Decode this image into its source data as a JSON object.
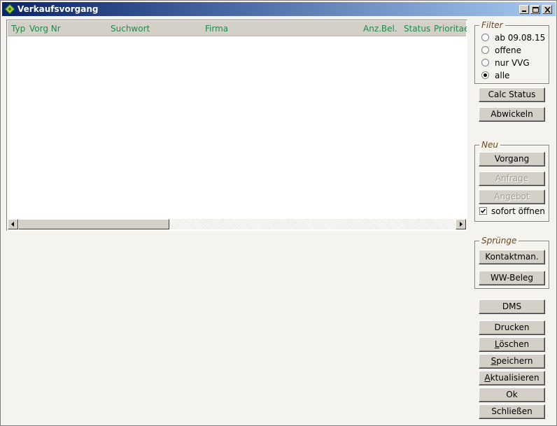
{
  "window": {
    "title": "Verkaufsvorgang",
    "icons": {
      "app": "green-diamond-arrows-icon",
      "minimize": "minimize-icon",
      "maximize": "maximize-icon",
      "close": "close-icon"
    }
  },
  "list": {
    "columns": [
      "Typ",
      "Vorg Nr",
      "Suchwort",
      "Firma",
      "Anz.Bel.",
      "Status",
      "Prioritae"
    ],
    "rows": [],
    "header_text_color": "#1e8a4a"
  },
  "filter": {
    "title": "Filter",
    "options": [
      {
        "label": "ab 09.08.15",
        "checked": false
      },
      {
        "label": "offene",
        "checked": false
      },
      {
        "label": "nur VVG",
        "checked": false
      },
      {
        "label": "alle",
        "checked": true
      }
    ]
  },
  "buttons": {
    "calc_status": "Calc Status",
    "abwickeln": "Abwickeln",
    "dms": "DMS",
    "drucken": "Drucken",
    "loeschen_rest": "öschen",
    "loeschen_accel": "L",
    "speichern_rest": "peichern",
    "speichern_accel": "S",
    "aktualisieren_rest": "ktualisieren",
    "aktualisieren_accel": "A",
    "ok": "Ok",
    "schliessen": "Schließen"
  },
  "neu": {
    "title": "Neu",
    "vorgang": "Vorgang",
    "anfrage": "Anfrage",
    "angebot": "Angebot",
    "sofort_oeffnen": "sofort öffnen",
    "sofort_oeffnen_checked": true
  },
  "spruenge": {
    "title": "Sprünge",
    "kontaktman": "Kontaktman.",
    "ww_beleg": "WW-Beleg"
  }
}
